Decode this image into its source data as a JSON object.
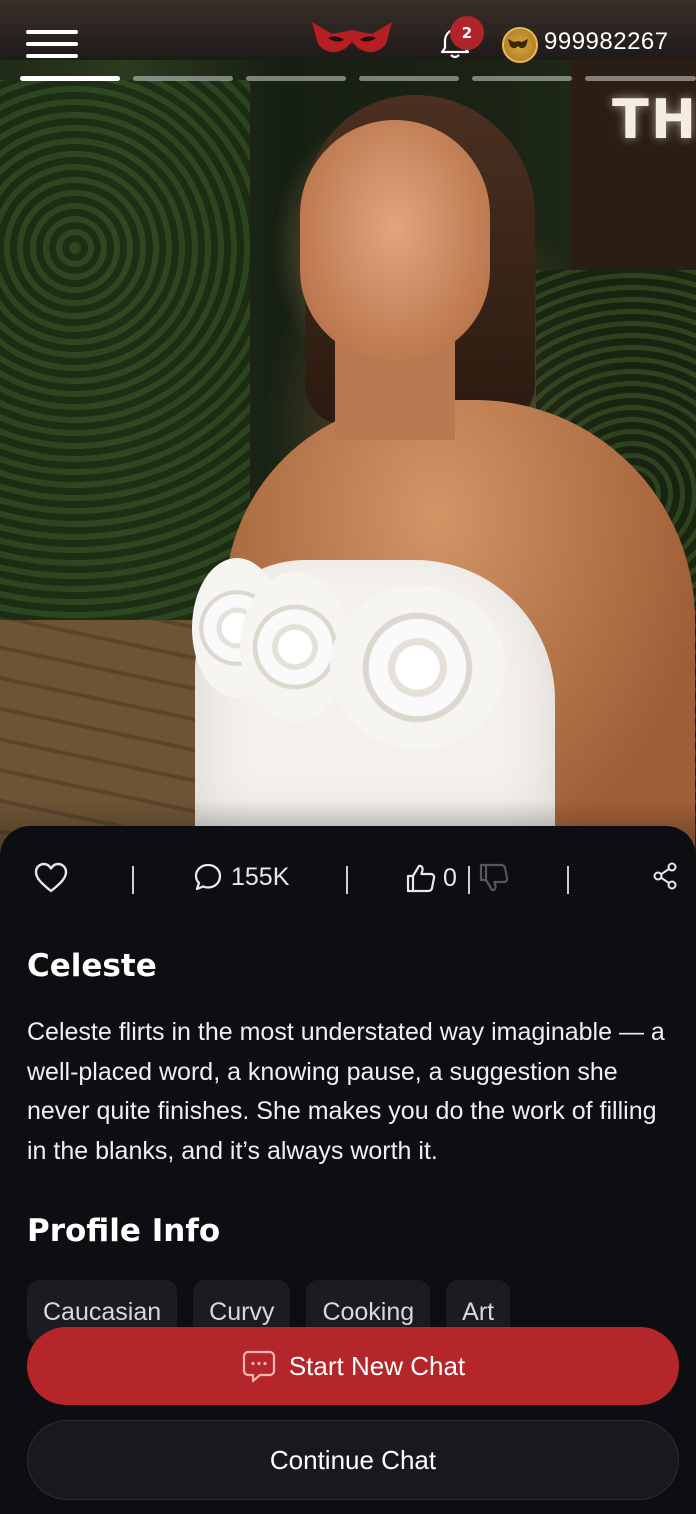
{
  "header": {
    "notification_count": "2",
    "coin_balance": "999982267",
    "story_count": 6,
    "story_active_index": 0
  },
  "hero": {
    "sign_text": "TH"
  },
  "stats": {
    "comments": "155K",
    "likes": "0"
  },
  "profile": {
    "name": "Celeste",
    "description": "Celeste flirts in the most understated way imaginable — a well-placed word, a knowing pause, a suggestion she never quite finishes. She makes you do the work of filling in the blanks, and it’s always worth it.",
    "section_title": "Profile Info",
    "tags": [
      "Caucasian",
      "Curvy",
      "Cooking",
      "Art"
    ]
  },
  "buttons": {
    "start_chat": "Start New Chat",
    "continue_chat": "Continue Chat"
  },
  "colors": {
    "accent": "#b5262b",
    "background": "#0d0e12",
    "tag_bg": "#1b1c22"
  },
  "icons": [
    "menu-icon",
    "brand-mask-logo",
    "bell-icon",
    "coin-mask-icon",
    "heart-icon",
    "comment-icon",
    "thumbs-up-icon",
    "thumbs-down-icon",
    "share-icon",
    "chat-bubble-icon"
  ]
}
